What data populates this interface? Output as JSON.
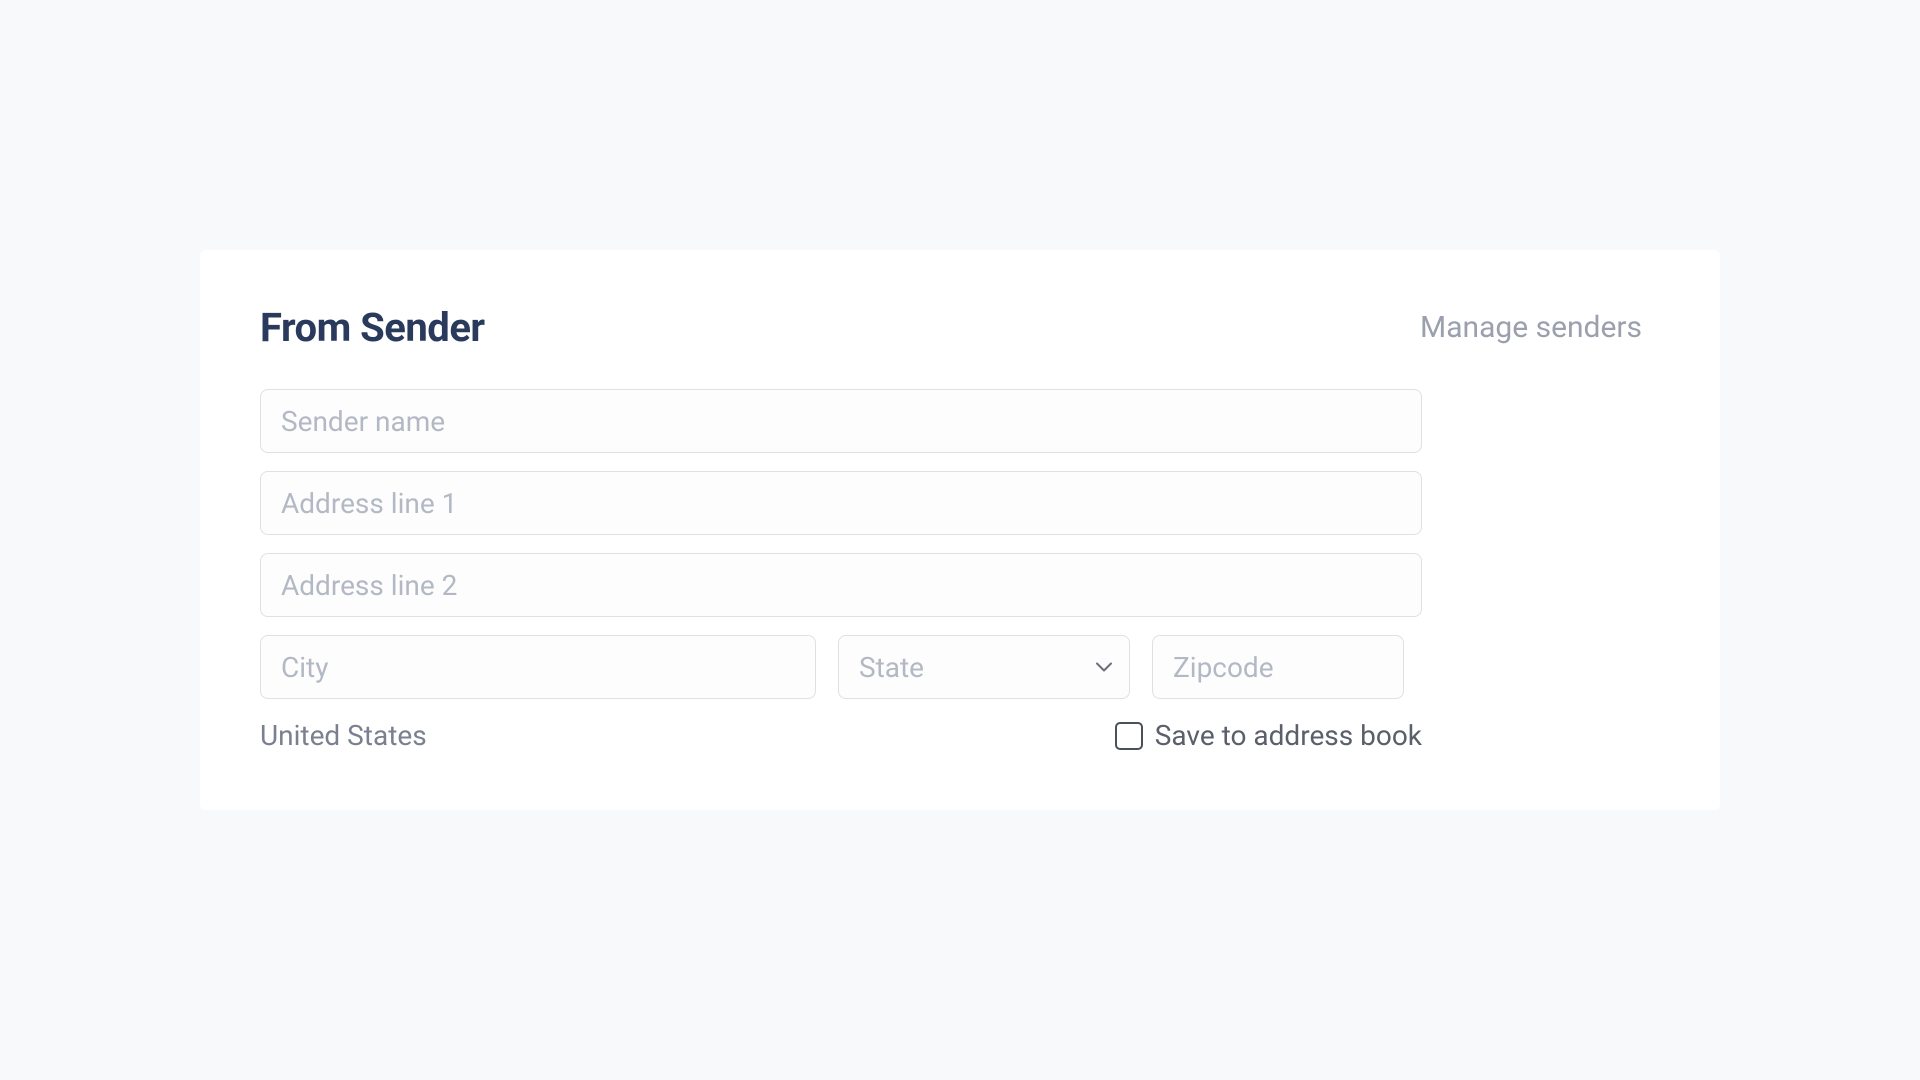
{
  "header": {
    "title": "From Sender",
    "manage_link": "Manage senders"
  },
  "fields": {
    "sender_name": {
      "placeholder": "Sender name",
      "value": ""
    },
    "address1": {
      "placeholder": "Address line 1",
      "value": ""
    },
    "address2": {
      "placeholder": "Address line 2",
      "value": ""
    },
    "city": {
      "placeholder": "City",
      "value": ""
    },
    "state": {
      "placeholder": "State",
      "value": ""
    },
    "zipcode": {
      "placeholder": "Zipcode",
      "value": ""
    }
  },
  "footer": {
    "country": "United States",
    "save_label": "Save to address book"
  }
}
